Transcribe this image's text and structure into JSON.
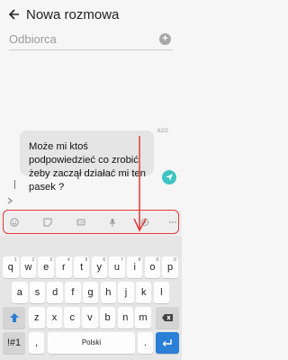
{
  "header": {
    "back_icon": "arrow-left-icon",
    "title": "Nowa rozmowa"
  },
  "recipient": {
    "placeholder": "Odbiorca",
    "add_icon": "plus-icon"
  },
  "message": {
    "counter": "62/2",
    "text": "Może mi ktoś podpowiedzieć co zrobić żeby zaczął działać mi ten pasek ?",
    "expand_icon": "chevron-right-icon",
    "send_icon": "send-icon"
  },
  "toolbar": {
    "icons": [
      "emoji-icon",
      "sticker-icon",
      "gif-icon",
      "microphone-icon",
      "settings-icon",
      "more-icon"
    ]
  },
  "keyboard": {
    "row1": [
      {
        "label": "q",
        "num": "1"
      },
      {
        "label": "w",
        "num": "2"
      },
      {
        "label": "e",
        "num": "3"
      },
      {
        "label": "r",
        "num": "4"
      },
      {
        "label": "t",
        "num": "5"
      },
      {
        "label": "y",
        "num": "6"
      },
      {
        "label": "u",
        "num": "7"
      },
      {
        "label": "i",
        "num": "8"
      },
      {
        "label": "o",
        "num": "9"
      },
      {
        "label": "p",
        "num": "0"
      }
    ],
    "row2": [
      "a",
      "s",
      "d",
      "f",
      "g",
      "h",
      "j",
      "k",
      "l"
    ],
    "row3": [
      "z",
      "x",
      "c",
      "v",
      "b",
      "n",
      "m"
    ],
    "symbols": "!#1",
    "comma": ",",
    "space": "Polski",
    "period": ".",
    "shift_icon": "shift-icon",
    "backspace_icon": "backspace-icon",
    "enter_icon": "enter-icon"
  },
  "annotation_color": "#e0393a",
  "accent": "#3fc3c3",
  "enter_key_color": "#2b7fd6"
}
